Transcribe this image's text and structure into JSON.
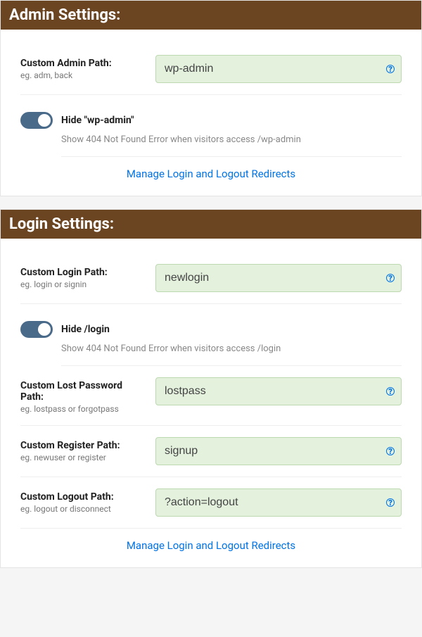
{
  "admin": {
    "header": "Admin Settings:",
    "custom_path": {
      "label": "Custom Admin Path:",
      "hint": "eg. adm, back",
      "value": "wp-admin"
    },
    "toggle": {
      "label": "Hide \"wp-admin\"",
      "desc": "Show 404 Not Found Error when visitors access /wp-admin",
      "enabled": true
    },
    "link": "Manage Login and Logout Redirects"
  },
  "login": {
    "header": "Login Settings:",
    "custom_path": {
      "label": "Custom Login Path:",
      "hint": "eg. login or signin",
      "value": "newlogin"
    },
    "toggle": {
      "label": "Hide /login",
      "desc": "Show 404 Not Found Error when visitors access /login",
      "enabled": true
    },
    "lost_password": {
      "label": "Custom Lost Password Path:",
      "hint": "eg. lostpass or forgotpass",
      "value": "lostpass"
    },
    "register": {
      "label": "Custom Register Path:",
      "hint": "eg. newuser or register",
      "value": "signup"
    },
    "logout": {
      "label": "Custom Logout Path:",
      "hint": "eg. logout or disconnect",
      "value": "?action=logout"
    },
    "link": "Manage Login and Logout Redirects"
  }
}
